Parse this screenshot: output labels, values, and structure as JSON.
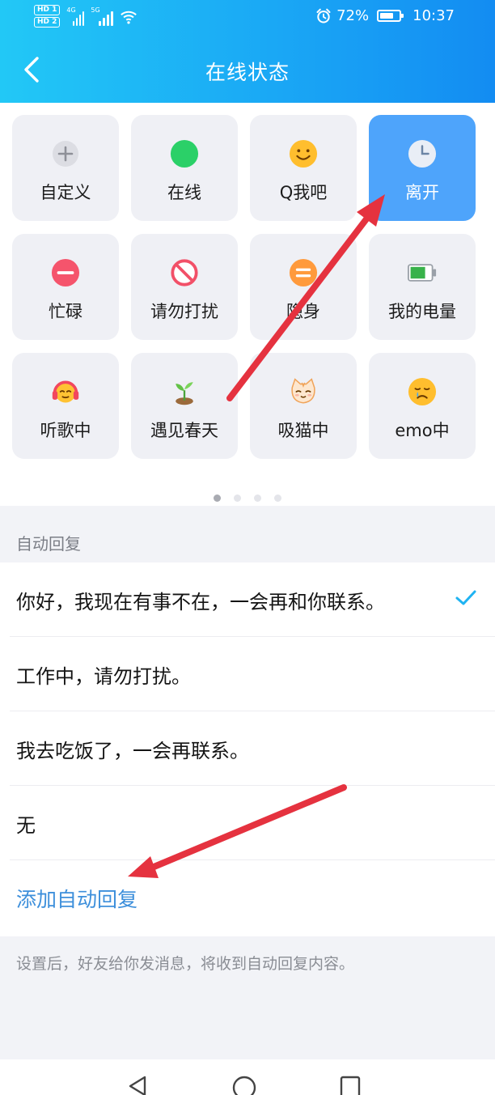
{
  "status_bar": {
    "hd1": "HD 1",
    "hd2": "HD 2",
    "sig1_label": "4G",
    "sig2_label": "5G",
    "battery_text": "72%",
    "battery_level": 0.72,
    "time": "10:37"
  },
  "header": {
    "title": "在线状态"
  },
  "statuses": [
    {
      "label": "自定义",
      "icon": "plus-icon"
    },
    {
      "label": "在线",
      "icon": "green-dot-icon"
    },
    {
      "label": "Q我吧",
      "icon": "smile-icon"
    },
    {
      "label": "离开",
      "icon": "clock-icon",
      "selected": true
    },
    {
      "label": "忙碌",
      "icon": "minus-circle-icon"
    },
    {
      "label": "请勿打扰",
      "icon": "no-entry-icon"
    },
    {
      "label": "隐身",
      "icon": "equals-circle-icon"
    },
    {
      "label": "我的电量",
      "icon": "battery-icon"
    },
    {
      "label": "听歌中",
      "icon": "headphones-face-icon"
    },
    {
      "label": "遇见春天",
      "icon": "sprout-icon"
    },
    {
      "label": "吸猫中",
      "icon": "cat-icon"
    },
    {
      "label": "emo中",
      "icon": "sad-face-icon"
    }
  ],
  "pagination": {
    "pages": 4,
    "active": 0
  },
  "auto_reply": {
    "section_label": "自动回复",
    "options": [
      {
        "text": "你好，我现在有事不在，一会再和你联系。",
        "selected": true
      },
      {
        "text": "工作中，请勿打扰。",
        "selected": false
      },
      {
        "text": "我去吃饭了，一会再联系。",
        "selected": false
      },
      {
        "text": "无",
        "selected": false
      }
    ],
    "add_label": "添加自动回复",
    "hint": "设置后，好友给你发消息，将收到自动回复内容。"
  },
  "colors": {
    "header_start": "#22c8f6",
    "header_end": "#138cf2",
    "selected_tile": "#4ea4fb",
    "accent_text": "#3d8fdb",
    "check": "#1fb3f2",
    "arrow": "#e5323f"
  }
}
